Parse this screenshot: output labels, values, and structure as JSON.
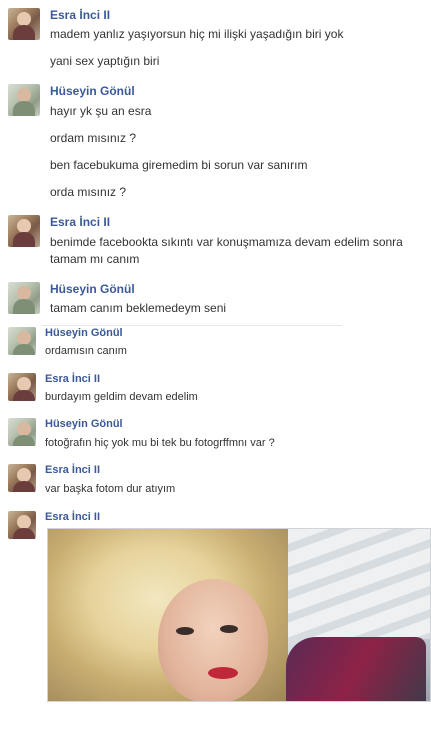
{
  "messages": [
    {
      "sender": "Esra İnci II",
      "lines": [
        "madem yanlız yaşıyorsun hiç mi ilişki yaşadığın biri yok",
        "yani sex yaptığın biri"
      ]
    },
    {
      "sender": "Hüseyin Gönül",
      "lines": [
        "hayır yk şu an esra",
        "ordam mısınız ?",
        "ben facebukuma giremedim bi sorun var sanırım",
        "orda mısınız ?"
      ]
    },
    {
      "sender": "Esra İnci II",
      "lines": [
        "benimde facebookta sıkıntı var konuşmamıza devam edelim sonra",
        "tamam mı canım"
      ]
    },
    {
      "sender": "Hüseyin Gönül",
      "lines": [
        "tamam  canım beklemedeym seni"
      ]
    },
    {
      "sender": "Hüseyin Gönül",
      "lines": [
        "ordamısın canım"
      ]
    },
    {
      "sender": "Esra İnci II",
      "lines": [
        "burdayım geldim devam edelim"
      ]
    },
    {
      "sender": "Hüseyin Gönül",
      "lines": [
        "fotoğrafın hiç yok mu bi tek bu fotogrffmnı var ?"
      ]
    },
    {
      "sender": "Esra İnci II",
      "lines": [
        "var başka fotom dur atıyım"
      ]
    },
    {
      "sender": "Esra İnci II",
      "lines": []
    }
  ],
  "colors": {
    "name": "#3b5998",
    "text": "#333333"
  }
}
